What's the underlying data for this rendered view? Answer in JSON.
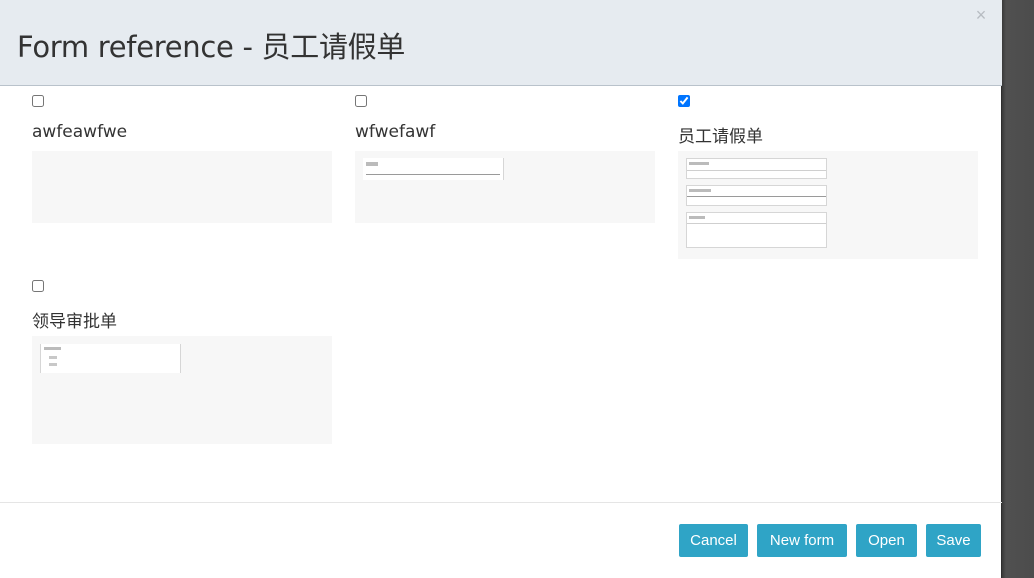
{
  "dialog": {
    "title": "Form reference - 员工请假单",
    "close_glyph": "×"
  },
  "forms": [
    {
      "name": "awfeawfwe",
      "checked": false
    },
    {
      "name": "wfwefawf",
      "checked": false
    },
    {
      "name": "员工请假单",
      "checked": true
    },
    {
      "name": "领导审批单",
      "checked": false
    }
  ],
  "footer": {
    "cancel_label": "Cancel",
    "new_form_label": "New form",
    "open_label": "Open",
    "save_label": "Save"
  },
  "colors": {
    "header_bg": "#e6ebf0",
    "button_bg": "#2fa4c6",
    "thumb_bg": "#f7f7f7"
  }
}
